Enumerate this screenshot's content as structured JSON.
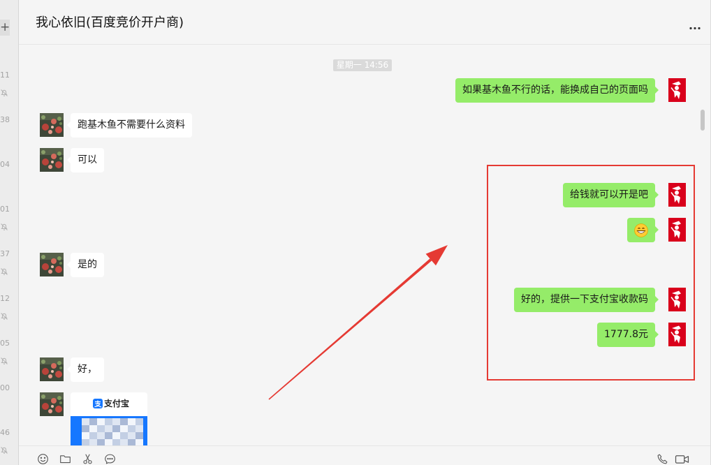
{
  "sidebar": {
    "add_button_label": "+",
    "entries": [
      {
        "time": "11",
        "muted": true
      },
      {
        "time": "38",
        "muted": false
      },
      {
        "time": "04",
        "muted": false
      },
      {
        "time": "01",
        "muted": true
      },
      {
        "time": "37",
        "muted": true
      },
      {
        "time": "12",
        "muted": true
      },
      {
        "time": "05",
        "muted": true
      },
      {
        "time": "00",
        "muted": false
      },
      {
        "time": "46",
        "muted": true
      }
    ]
  },
  "chat": {
    "title": "我心依旧(百度竞价开户商)",
    "timestamp": "星期一 14:56",
    "messages": [
      {
        "outgoing": true,
        "text": "如果基木鱼不行的话，能换成自己的页面吗"
      },
      {
        "outgoing": false,
        "text": "跑基木鱼不需要什么资料"
      },
      {
        "outgoing": false,
        "text": "可以"
      },
      {
        "outgoing": true,
        "text": "给钱就可以开是吧"
      },
      {
        "outgoing": true,
        "emoji_icon": "grinning-face-icon"
      },
      {
        "outgoing": false,
        "text": "是的"
      },
      {
        "outgoing": true,
        "text": "好的，提供一下支付宝收款码"
      },
      {
        "outgoing": true,
        "text": "1777.8元"
      },
      {
        "outgoing": false,
        "text": "好，"
      },
      {
        "outgoing": false,
        "card": {
          "brand": "支付宝",
          "logo_icon": "alipay-logo-icon"
        }
      }
    ]
  },
  "toolbar": {
    "left_icons": [
      "emoji-icon",
      "folder-icon",
      "scissors-icon",
      "chat-history-icon"
    ],
    "right_icons": [
      "phone-icon",
      "video-call-icon"
    ]
  },
  "colors": {
    "self_bubble": "#95ec69",
    "peer_bubble": "#ffffff",
    "timestamp_bg": "#dadada",
    "annotation": "#e53a33",
    "alipay_blue": "#1677ff"
  }
}
